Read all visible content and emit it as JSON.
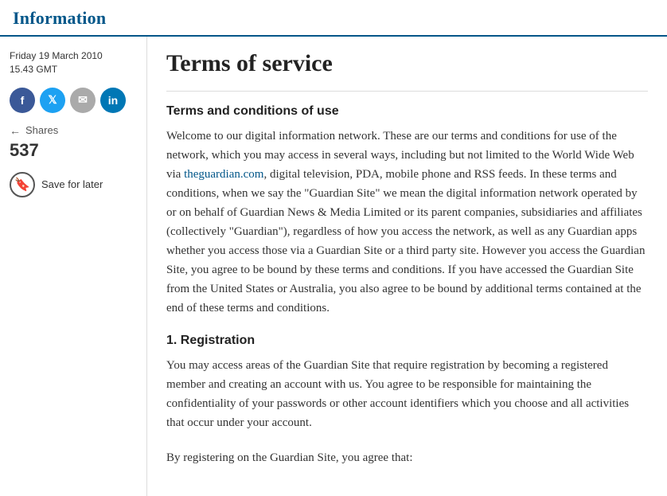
{
  "header": {
    "title": "Information"
  },
  "sidebar": {
    "date_line1": "Friday 19 March 2010",
    "date_line2": "15.43 GMT",
    "social_buttons": [
      {
        "name": "facebook",
        "label": "f",
        "class": "facebook"
      },
      {
        "name": "twitter",
        "label": "t",
        "class": "twitter"
      },
      {
        "name": "email",
        "label": "✉",
        "class": "email"
      },
      {
        "name": "linkedin",
        "label": "in",
        "class": "linkedin"
      }
    ],
    "shares_label": "Shares",
    "shares_count": "537",
    "save_later_label": "Save for later"
  },
  "article": {
    "title": "Terms of service",
    "section1_title": "Terms and conditions of use",
    "section1_body_part1": "Welcome to our digital information network. These are our terms and conditions for use of the network, which you may access in several ways, including but not limited to the World Wide Web via ",
    "section1_link_text": "theguardian.com",
    "section1_link_href": "#",
    "section1_body_part2": ", digital television, PDA, mobile phone and RSS feeds. In these terms and conditions, when we say the \"Guardian Site\" we mean the digital information network operated by or on behalf of Guardian News & Media Limited or its parent companies, subsidiaries and affiliates (collectively \"Guardian\"), regardless of how you access the network, as well as any Guardian apps whether you access those via a Guardian Site or a third party site. However you access the Guardian Site, you agree to be bound by these terms and conditions. If you have accessed the Guardian Site from the United States or Australia, you also agree to be bound by additional terms contained at the end of these terms and conditions.",
    "section2_title": "1. Registration",
    "section2_body_part1": "You may access areas of the Guardian Site that require registration by becoming a registered member and creating an account with us. You agree to be responsible for maintaining the confidentiality of your passwords or other account identifiers which you choose and all activities that occur under your account.",
    "section2_body_part2": "By registering on the Guardian Site, you agree that:"
  }
}
